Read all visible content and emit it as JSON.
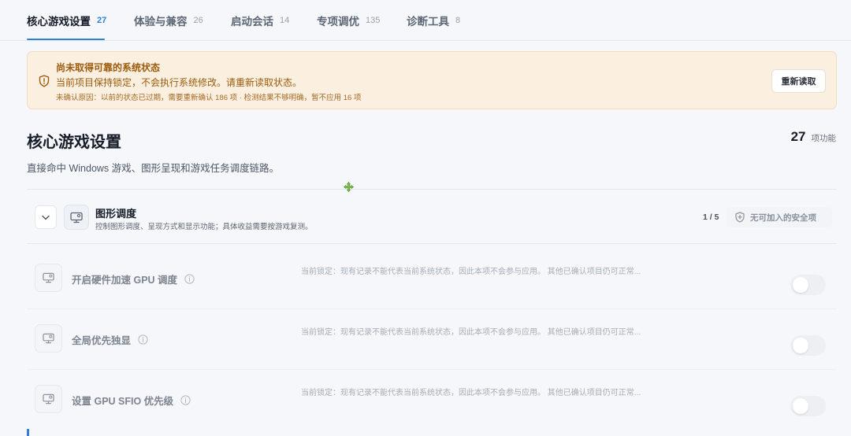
{
  "tabs": [
    {
      "label": "核心游戏设置",
      "count": "27",
      "active": true
    },
    {
      "label": "体验与兼容",
      "count": "26",
      "active": false
    },
    {
      "label": "启动会话",
      "count": "14",
      "active": false
    },
    {
      "label": "专项调优",
      "count": "135",
      "active": false
    },
    {
      "label": "诊断工具",
      "count": "8",
      "active": false
    }
  ],
  "banner": {
    "title": "尚未取得可靠的系统状态",
    "message": "当前项目保持锁定，不会执行系统修改。请重新读取状态。",
    "detail": "未确认原因：以前的状态已过期，需要重新确认 186 项 · 检测结果不够明确，暂不应用 16 项",
    "reload_label": "重新读取"
  },
  "section": {
    "title": "核心游戏设置",
    "description": "直接命中 Windows 游戏、图形呈现和游戏任务调度链路。",
    "count": "27",
    "count_unit": "项功能"
  },
  "group": {
    "title": "图形调度",
    "description": "控制图形调度、呈现方式和显示功能；具体收益需要按游戏复测。",
    "progress": "1 / 5",
    "tag": "无可加入的安全项"
  },
  "items": [
    {
      "name": "开启硬件加速 GPU 调度",
      "note": "当前锁定：现有记录不能代表当前系统状态，因此本项不会参与应用。 其他已确认项目仍可正常...",
      "enabled": false
    },
    {
      "name": "全局优先独显",
      "note": "当前锁定：现有记录不能代表当前系统状态，因此本项不会参与应用。 其他已确认项目仍可正常...",
      "enabled": false
    },
    {
      "name": "设置 GPU SFIO 优先级",
      "note": "当前锁定：现有记录不能代表当前系统状态，因此本项不会参与应用。 其他已确认项目仍可正常...",
      "enabled": false
    }
  ],
  "colors": {
    "accent": "#2f7fd6",
    "warning_bg": "#fbefdf",
    "warning_text": "#9b5b0d",
    "cursor": "#7bc143"
  },
  "icons": {
    "banner": "shield-alert-icon",
    "group_toggle": "chevron-down-icon",
    "group": "monitor-settings-icon",
    "tag": "shield-plus-icon",
    "item": "monitor-settings-icon",
    "info": "info-icon",
    "cursor": "move-cursor-icon"
  }
}
